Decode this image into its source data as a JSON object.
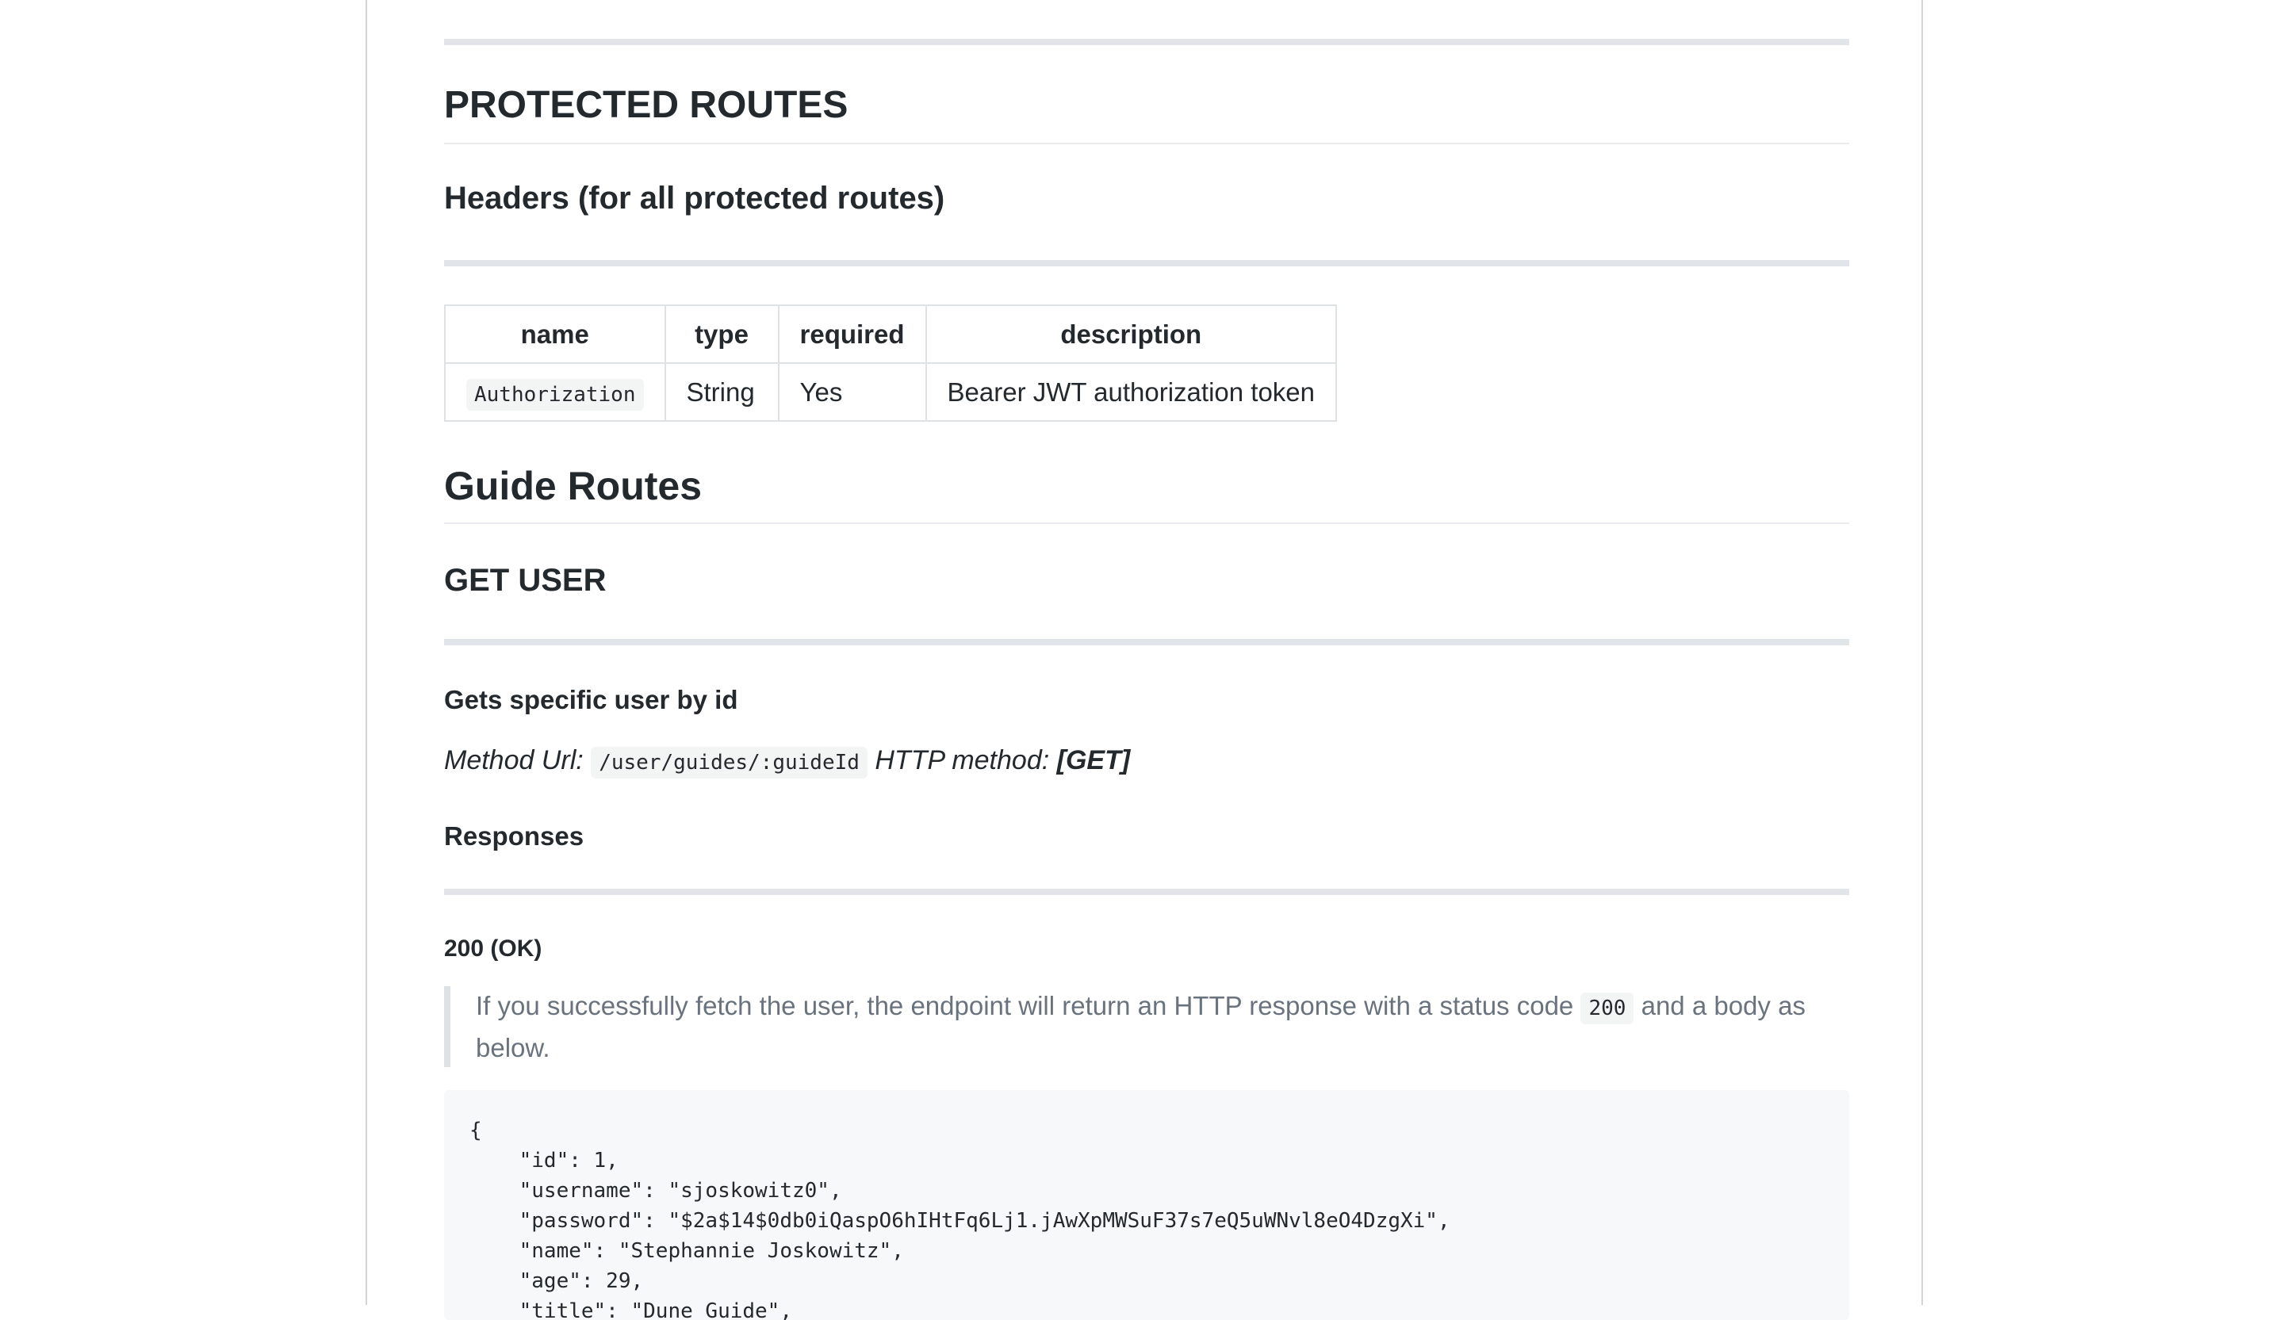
{
  "sections": {
    "protected_routes": "PROTECTED ROUTES",
    "headers_title": "Headers (for all protected routes)",
    "guide_routes": "Guide Routes",
    "get_user": "GET USER",
    "gets_specific": "Gets specific user by id",
    "responses": "Responses",
    "status_200": "200 (OK)"
  },
  "headers_table": {
    "columns": [
      "name",
      "type",
      "required",
      "description"
    ],
    "rows": [
      {
        "name": "Authorization",
        "type": "String",
        "required": "Yes",
        "description": "Bearer JWT authorization token"
      }
    ]
  },
  "method": {
    "url_label": "Method Url:",
    "url": "/user/guides/:guideId",
    "http_label": "HTTP method:",
    "http_method": "[GET]"
  },
  "response_200": {
    "text_before": "If you successfully fetch the user, the endpoint will return an HTTP response with a status code",
    "code": "200",
    "text_after": "and a body as below."
  },
  "code_block": {
    "lines": [
      "{",
      "    \"id\": 1,",
      "    \"username\": \"sjoskowitz0\",",
      "    \"password\": \"$2a$14$0db0iQaspO6hIHtFq6Lj1.jAwXpMWSuF37s7eQ5uWNvl8eO4DzgXi\",",
      "    \"name\": \"Stephannie Joskowitz\",",
      "    \"age\": 29,",
      "    \"title\": \"Dune Guide\","
    ]
  }
}
